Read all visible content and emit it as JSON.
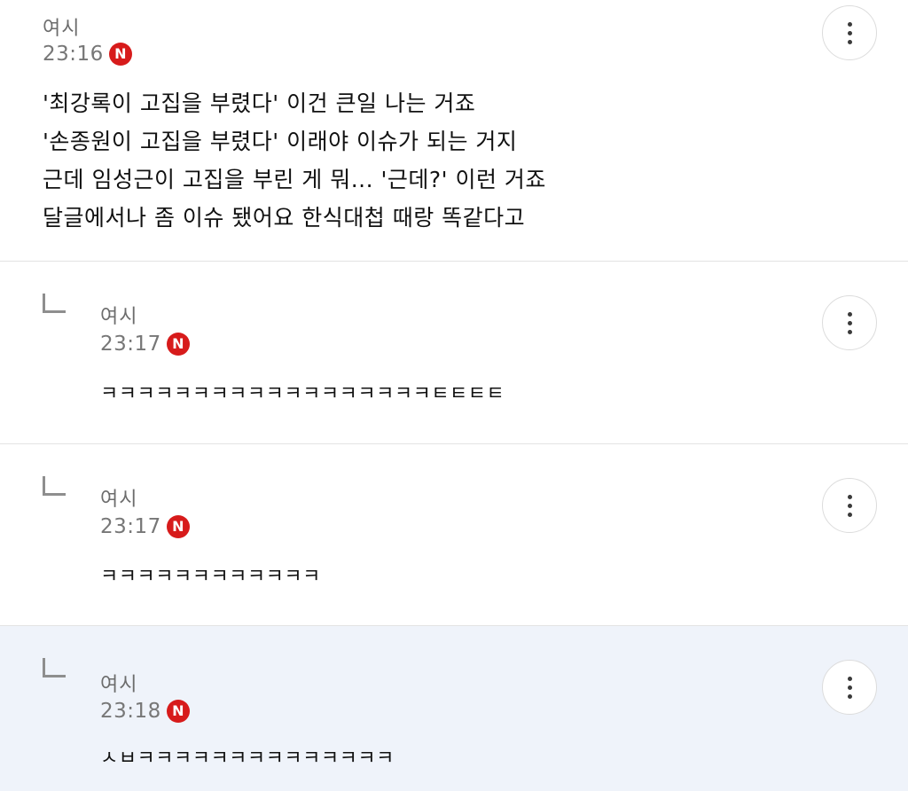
{
  "comments": [
    {
      "author": "여시",
      "time": "23:16",
      "badge": "N",
      "text": "'최강록이 고집을 부렸다' 이건 큰일 나는 거죠\n'손종원이 고집을 부렸다' 이래야 이슈가 되는 거지\n근데 임성근이 고집을 부린 게 뭐... '근데?' 이런 거죠\n달글에서나 좀 이슈 됐어요 한식대첩 때랑 똑같다고"
    },
    {
      "author": "여시",
      "time": "23:17",
      "badge": "N",
      "text": "ㅋㅋㅋㅋㅋㅋㅋㅋㅋㅋㅋㅋㅋㅋㅋㅋㅋㅋㅌㅌㅌㅌ"
    },
    {
      "author": "여시",
      "time": "23:17",
      "badge": "N",
      "text": "ㅋㅋㅋㅋㅋㅋㅋㅋㅋㅋㅋㅋ"
    },
    {
      "author": "여시",
      "time": "23:18",
      "badge": "N",
      "text": "ㅅㅂㅋㅋㅋㅋㅋㅋㅋㅋㅋㅋㅋㅋㅋㅋ"
    }
  ],
  "colors": {
    "badge": "#d71b1b",
    "highlight_row": "#eff3fa"
  },
  "icons": {
    "more": "more-vertical-icon",
    "reply": "reply-arrow-icon"
  }
}
